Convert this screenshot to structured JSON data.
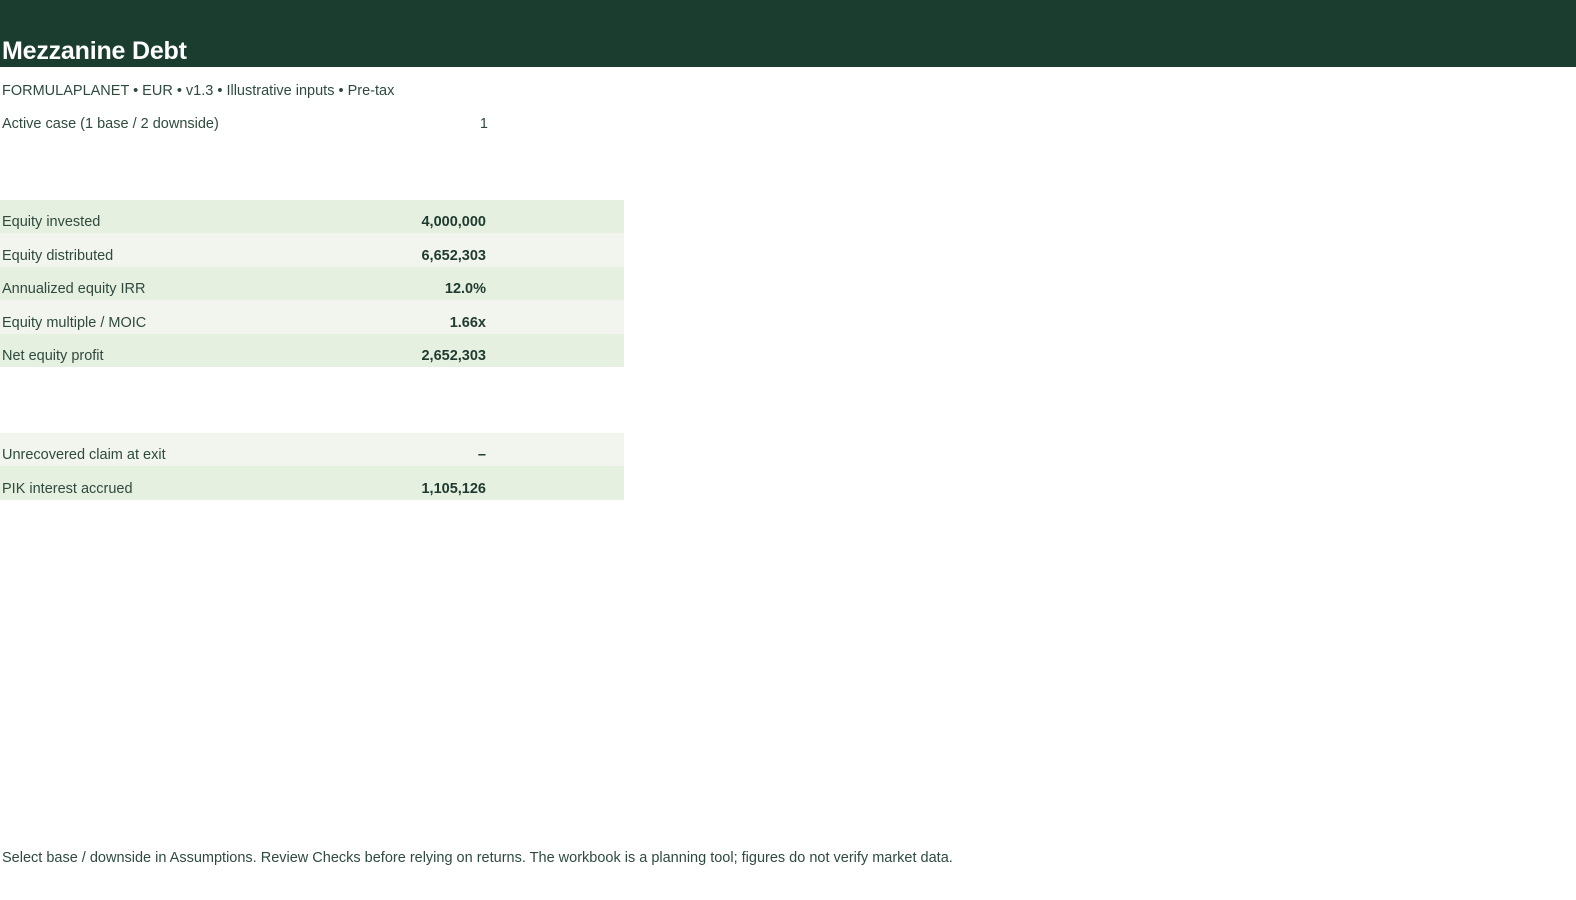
{
  "header": {
    "title": "Mezzanine Debt",
    "subtitle": "FORMULAPLANET  •  EUR  •  v1.3  •  Illustrative inputs  •  Pre-tax"
  },
  "case": {
    "label": "Active case (1 base / 2 downside)",
    "value": "1"
  },
  "returns": [
    {
      "label": "Equity invested",
      "value": "4,000,000"
    },
    {
      "label": "Equity distributed",
      "value": "6,652,303"
    },
    {
      "label": "Annualized equity IRR",
      "value": "12.0%"
    },
    {
      "label": "Equity multiple / MOIC",
      "value": "1.66x"
    },
    {
      "label": "Net equity profit",
      "value": "2,652,303"
    }
  ],
  "claims": [
    {
      "label": "Unrecovered claim at exit",
      "value": "–"
    },
    {
      "label": "PIK interest accrued",
      "value": "1,105,126"
    }
  ],
  "footer": {
    "note": "Select base / downside in Assumptions. Review Checks before relying on returns. The workbook is a planning tool; figures do not verify market data."
  },
  "colors": {
    "header_bg": "#1b3d30",
    "row_band_a": "#e6f0e1",
    "row_band_b": "#f1f5ee",
    "text": "#2e4a3d"
  }
}
